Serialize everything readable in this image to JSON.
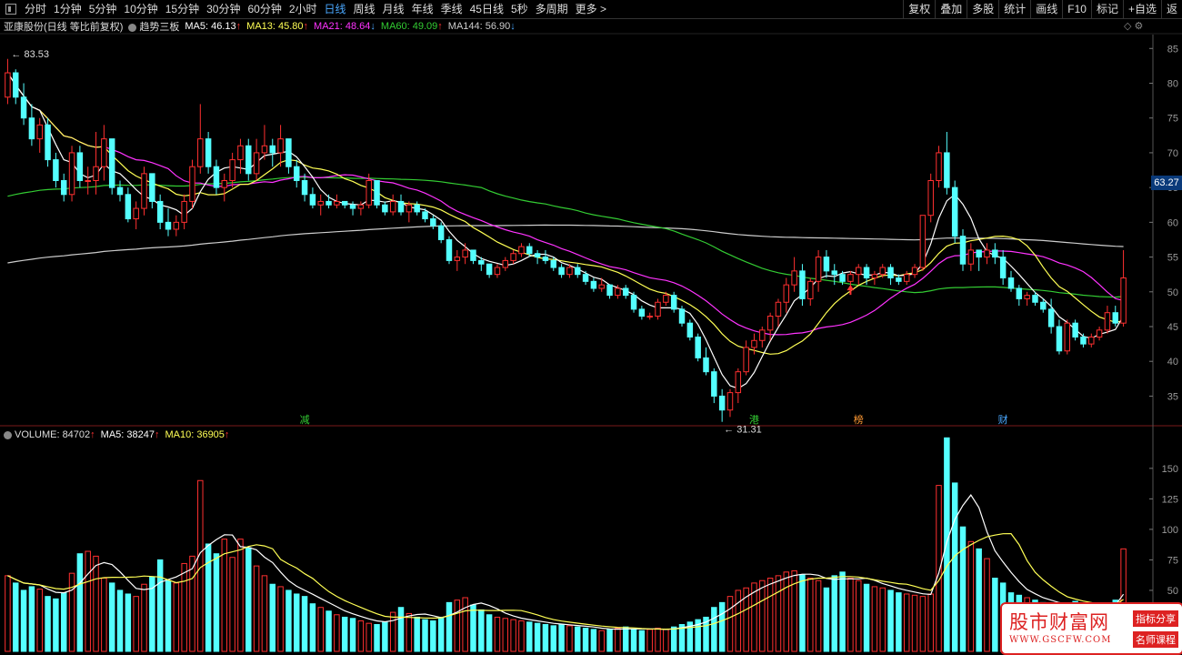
{
  "toolbar": {
    "periods": [
      "分时",
      "1分钟",
      "5分钟",
      "10分钟",
      "15分钟",
      "30分钟",
      "60分钟",
      "2小时",
      "日线",
      "周线",
      "月线",
      "年线",
      "季线",
      "45日线",
      "5秒",
      "多周期",
      "更多 >"
    ],
    "active": "日线",
    "right": [
      "复权",
      "叠加",
      "多股",
      "统计",
      "画线",
      "F10",
      "标记",
      "+自选",
      "返"
    ]
  },
  "info": {
    "stock": "亚康股份(日线 等比前复权)",
    "indicator": "趋势三板",
    "ma5": "MA5: 46.13",
    "ma13": "MA13: 45.80",
    "ma21": "MA21: 48.64",
    "ma60": "MA60: 49.09",
    "ma144": "MA144: 56.90",
    "arrow_up": "↑",
    "arrow_down": "↓"
  },
  "volinfo": {
    "vol": "VOLUME: 84702",
    "ma5": "MA5: 38247",
    "ma10": "MA10: 36905"
  },
  "price_tag": "63.27",
  "annotations": {
    "high": "83.53",
    "low": "31.31",
    "m1": "减",
    "m2": "港",
    "m3": "榜",
    "m4": "财"
  },
  "watermark": {
    "main": "股市财富网",
    "url": "WWW.GSCFW.COM",
    "tag1": "指标分享",
    "tag2": "名师课程"
  },
  "colors": {
    "up": "#ff3030",
    "down": "#54ffff",
    "ma5": "#ffffff",
    "ma13": "#ffff55",
    "ma21": "#ff33ff",
    "ma60": "#33cc33",
    "ma144": "#cccccc"
  },
  "chart_data": {
    "type": "candlestick",
    "yticks": [
      35,
      40,
      45,
      50,
      55,
      60,
      65,
      70,
      75,
      80,
      85
    ],
    "vticks": [
      50,
      75,
      100,
      125,
      150
    ],
    "ylim": [
      31,
      87
    ],
    "vlim": [
      0,
      170
    ],
    "candles": [
      [
        78,
        83.5,
        77,
        81.5
      ],
      [
        81.5,
        82,
        77,
        78
      ],
      [
        78,
        80,
        74,
        75
      ],
      [
        75,
        77,
        71,
        72
      ],
      [
        72,
        75,
        70,
        74
      ],
      [
        74,
        75,
        68,
        69
      ],
      [
        69,
        70,
        65,
        66
      ],
      [
        66,
        67,
        63,
        64
      ],
      [
        64,
        71,
        63,
        70
      ],
      [
        70,
        71,
        65,
        66
      ],
      [
        66,
        68,
        64,
        66
      ],
      [
        66,
        73,
        64,
        68
      ],
      [
        68,
        74,
        66,
        72
      ],
      [
        72,
        72,
        64,
        65
      ],
      [
        65,
        66,
        63,
        64
      ],
      [
        64,
        65,
        60,
        60.5
      ],
      [
        60.5,
        63,
        59,
        62
      ],
      [
        62,
        68,
        61,
        67
      ],
      [
        67,
        67,
        62,
        63
      ],
      [
        63,
        64,
        59,
        60
      ],
      [
        60,
        62,
        58,
        59
      ],
      [
        59,
        61,
        58,
        60
      ],
      [
        60,
        64,
        59,
        63
      ],
      [
        63,
        69,
        62,
        68
      ],
      [
        68,
        77,
        67,
        72
      ],
      [
        72,
        73,
        67,
        68
      ],
      [
        68,
        69,
        64,
        65
      ],
      [
        65,
        67,
        63,
        66
      ],
      [
        66,
        70,
        65,
        69
      ],
      [
        69,
        72,
        67,
        71
      ],
      [
        71,
        72,
        66,
        67
      ],
      [
        67,
        72,
        66,
        70
      ],
      [
        70,
        74,
        69,
        71
      ],
      [
        71,
        72,
        68,
        70
      ],
      [
        70,
        74,
        68,
        72
      ],
      [
        72,
        72,
        67,
        68
      ],
      [
        68,
        69,
        65,
        66
      ],
      [
        66,
        67,
        63,
        64
      ],
      [
        64,
        65,
        62,
        62.5
      ],
      [
        62.5,
        64,
        61,
        63
      ],
      [
        63,
        64,
        62,
        62.5
      ],
      [
        62.5,
        64,
        62,
        63
      ],
      [
        63,
        63,
        62,
        62.5
      ],
      [
        62.5,
        63,
        61,
        62
      ],
      [
        62,
        63,
        61,
        62.5
      ],
      [
        62.5,
        67,
        62,
        66
      ],
      [
        66,
        66,
        62,
        62.5
      ],
      [
        62.5,
        63,
        61,
        61.5
      ],
      [
        61.5,
        64,
        61,
        63
      ],
      [
        63,
        64,
        61,
        61.5
      ],
      [
        61.5,
        63,
        60,
        62.5
      ],
      [
        62.5,
        63,
        61,
        61.5
      ],
      [
        61.5,
        62,
        60,
        60.5
      ],
      [
        60.5,
        61,
        59,
        59.5
      ],
      [
        59.5,
        60,
        57,
        57.5
      ],
      [
        57.5,
        58,
        54,
        54.5
      ],
      [
        54.5,
        56,
        53,
        55
      ],
      [
        55,
        57,
        54,
        56
      ],
      [
        56,
        56,
        54,
        54.5
      ],
      [
        54.5,
        55,
        53,
        54
      ],
      [
        54,
        54,
        52,
        52.5
      ],
      [
        52.5,
        54,
        52,
        53.5
      ],
      [
        53.5,
        55,
        53,
        54.5
      ],
      [
        54.5,
        56,
        54,
        55.5
      ],
      [
        55.5,
        57,
        55,
        56.5
      ],
      [
        56.5,
        57,
        55,
        55.5
      ],
      [
        55.5,
        56,
        54,
        55
      ],
      [
        55,
        56,
        54,
        54.5
      ],
      [
        54.5,
        55,
        53,
        53.5
      ],
      [
        53.5,
        54,
        52,
        52.5
      ],
      [
        52.5,
        54,
        52,
        53.5
      ],
      [
        53.5,
        54,
        52,
        52.5
      ],
      [
        52.5,
        53,
        51,
        51.5
      ],
      [
        51.5,
        52,
        50,
        50.5
      ],
      [
        50.5,
        52,
        50,
        51
      ],
      [
        51,
        51,
        49,
        49.5
      ],
      [
        49.5,
        51,
        49,
        50.5
      ],
      [
        50.5,
        51,
        49,
        49.5
      ],
      [
        49.5,
        50,
        47,
        47.5
      ],
      [
        47.5,
        48,
        46,
        46.5
      ],
      [
        46.5,
        47,
        46,
        46.5
      ],
      [
        46.5,
        49,
        46,
        48.5
      ],
      [
        48.5,
        50,
        48,
        49.5
      ],
      [
        49.5,
        50,
        47,
        47.5
      ],
      [
        47.5,
        48,
        45,
        45.5
      ],
      [
        45.5,
        46,
        43,
        43.5
      ],
      [
        43.5,
        44,
        40,
        40.5
      ],
      [
        40.5,
        42,
        38,
        38.5
      ],
      [
        38.5,
        39,
        34,
        35
      ],
      [
        35,
        36,
        31.3,
        33
      ],
      [
        33,
        36,
        32,
        35.5
      ],
      [
        35.5,
        39,
        34,
        38.5
      ],
      [
        38.5,
        43,
        38,
        42
      ],
      [
        42,
        44,
        41,
        43
      ],
      [
        43,
        45,
        42,
        44.5
      ],
      [
        44.5,
        47,
        43,
        46.5
      ],
      [
        46.5,
        49,
        45,
        48.5
      ],
      [
        48.5,
        52,
        47,
        51
      ],
      [
        51,
        55,
        50,
        53
      ],
      [
        53,
        54,
        48,
        49
      ],
      [
        49,
        52,
        48,
        51.5
      ],
      [
        51.5,
        56,
        50,
        55
      ],
      [
        55,
        56,
        52,
        53
      ],
      [
        53,
        54,
        51,
        52.5
      ],
      [
        52.5,
        53,
        51,
        51.5
      ],
      [
        51.5,
        53,
        50,
        52.5
      ],
      [
        52.5,
        54,
        51,
        53.5
      ],
      [
        53.5,
        54,
        51,
        52
      ],
      [
        52,
        53,
        51,
        52.5
      ],
      [
        52.5,
        54,
        52,
        53.5
      ],
      [
        53.5,
        54,
        51,
        52
      ],
      [
        52,
        52.5,
        51,
        51.5
      ],
      [
        51.5,
        53,
        51,
        52.5
      ],
      [
        52.5,
        54,
        52,
        53.5
      ],
      [
        53.5,
        61,
        53,
        61
      ],
      [
        61,
        67,
        60,
        66
      ],
      [
        66,
        71,
        65,
        70
      ],
      [
        70,
        73,
        64,
        65
      ],
      [
        65,
        66,
        57,
        58
      ],
      [
        58,
        59,
        53,
        54
      ],
      [
        54,
        57,
        53,
        56
      ],
      [
        56,
        56,
        53,
        55
      ],
      [
        55,
        57,
        54,
        56
      ],
      [
        56,
        57,
        54,
        55
      ],
      [
        55,
        56,
        51,
        52
      ],
      [
        52,
        53,
        50,
        50.5
      ],
      [
        50.5,
        51,
        48,
        49
      ],
      [
        49,
        50,
        48,
        49.5
      ],
      [
        49.5,
        50,
        48,
        48.5
      ],
      [
        48.5,
        49,
        47,
        47.5
      ],
      [
        47.5,
        49,
        44,
        45
      ],
      [
        45,
        46,
        41,
        41.5
      ],
      [
        41.5,
        46,
        41,
        45.5
      ],
      [
        45.5,
        46,
        43,
        43.5
      ],
      [
        43.5,
        44,
        42,
        42.5
      ],
      [
        42.5,
        44,
        42,
        43.5
      ],
      [
        43.5,
        45,
        43,
        44.5
      ],
      [
        44.5,
        48,
        44,
        47
      ],
      [
        47,
        48,
        45,
        45.5
      ],
      [
        45.5,
        56,
        45,
        52
      ]
    ],
    "volumes": [
      62,
      56,
      50,
      53,
      51,
      45,
      43,
      48,
      64,
      80,
      82,
      78,
      60,
      56,
      50,
      47,
      45,
      55,
      61,
      75,
      58,
      56,
      72,
      78,
      140,
      88,
      80,
      92,
      77,
      92,
      85,
      70,
      62,
      55,
      53,
      50,
      47,
      45,
      39,
      36,
      33,
      30,
      28,
      27,
      25,
      23,
      22,
      24,
      32,
      36,
      31,
      28,
      26,
      25,
      28,
      40,
      42,
      44,
      38,
      34,
      30,
      28,
      27,
      26,
      25,
      24,
      23,
      22,
      21,
      22,
      21,
      20,
      19,
      18,
      17,
      18,
      19,
      20,
      18,
      17,
      18,
      19,
      18,
      20,
      22,
      24,
      26,
      28,
      36,
      40,
      45,
      50,
      52,
      56,
      58,
      60,
      62,
      65,
      66,
      63,
      60,
      58,
      52,
      62,
      65,
      60,
      58,
      55,
      53,
      52,
      50,
      48,
      47,
      46,
      45,
      47,
      136,
      175,
      138,
      102,
      90,
      84,
      76,
      60,
      56,
      48,
      46,
      44,
      42,
      40,
      38,
      36,
      38,
      41,
      39,
      36,
      34,
      38,
      42,
      84
    ]
  }
}
